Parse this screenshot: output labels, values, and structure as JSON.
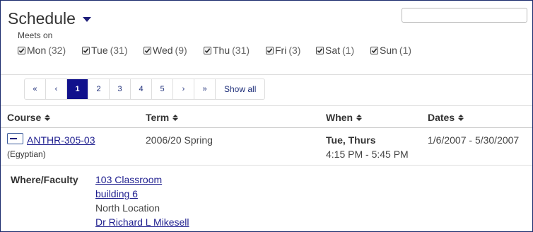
{
  "header": {
    "title": "Schedule"
  },
  "search": {
    "value": "",
    "placeholder": ""
  },
  "meets_on": {
    "label": "Meets on",
    "days": [
      {
        "label": "Mon",
        "count": "(32)",
        "checked": true
      },
      {
        "label": "Tue",
        "count": "(31)",
        "checked": true
      },
      {
        "label": "Wed",
        "count": "(9)",
        "checked": true
      },
      {
        "label": "Thu",
        "count": "(31)",
        "checked": true
      },
      {
        "label": "Fri",
        "count": "(3)",
        "checked": true
      },
      {
        "label": "Sat",
        "count": "(1)",
        "checked": true
      },
      {
        "label": "Sun",
        "count": "(1)",
        "checked": true
      }
    ]
  },
  "pagination": {
    "first": "«",
    "prev": "‹",
    "pages": [
      "1",
      "2",
      "3",
      "4",
      "5"
    ],
    "active_page": "1",
    "next": "›",
    "last": "»",
    "show_all": "Show all"
  },
  "table": {
    "headers": {
      "course": "Course",
      "term": "Term",
      "when": "When",
      "dates": "Dates"
    },
    "row": {
      "course_code": "ANTHR-305-03",
      "course_name": "(Egyptian)",
      "term": "2006/20 Spring",
      "days": "Tue, Thurs",
      "time": "4:15 PM - 5:45 PM",
      "dates": "1/6/2007 - 5/30/2007"
    },
    "detail": {
      "label": "Where/Faculty",
      "room": "103 Classroom",
      "building": "building 6",
      "location": "North Location",
      "faculty": "Dr Richard L Mikesell"
    }
  },
  "colors": {
    "accent": "#11118c",
    "link": "#1f1f8f",
    "border": "#1a2a6c"
  }
}
